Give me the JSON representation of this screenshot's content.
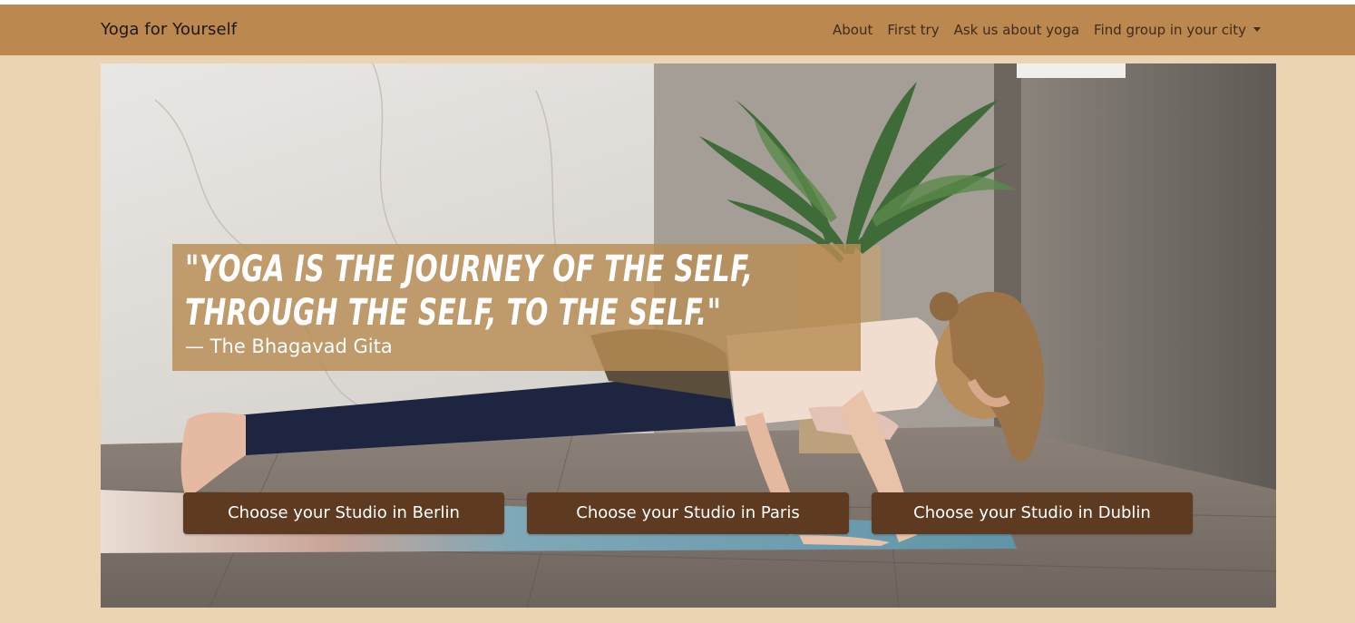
{
  "navbar": {
    "brand": "Yoga for Yourself",
    "links": [
      {
        "label": "About"
      },
      {
        "label": "First try"
      },
      {
        "label": "Ask us about yoga"
      },
      {
        "label": "Find group in your city"
      }
    ]
  },
  "hero": {
    "quote": "\"Yoga is the journey of the self, through the self, to the self.\"",
    "author": "— The Bhagavad Gita",
    "buttons": [
      {
        "label": "Choose your Studio in Berlin"
      },
      {
        "label": "Choose your Studio in Paris"
      },
      {
        "label": "Choose your Studio in Dublin"
      }
    ]
  },
  "colors": {
    "page_background": "#ebd4b3",
    "navbar": "#bb884f",
    "button": "#5e3a20",
    "quote_overlay": "#b88c54"
  },
  "icons": {
    "dropdown": "caret-down-icon"
  }
}
